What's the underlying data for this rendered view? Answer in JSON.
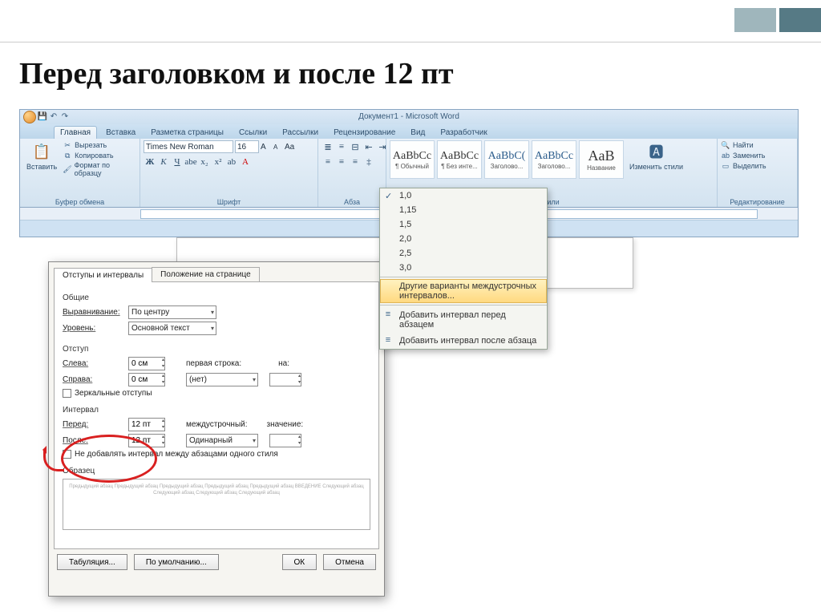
{
  "slide": {
    "heading": "Перед заголовком и после 12 пт"
  },
  "word": {
    "title": "Документ1 - Microsoft Word",
    "tabs": [
      "Главная",
      "Вставка",
      "Разметка страницы",
      "Ссылки",
      "Рассылки",
      "Рецензирование",
      "Вид",
      "Разработчик"
    ],
    "clipboard": {
      "label": "Буфер обмена",
      "paste": "Вставить",
      "cut": "Вырезать",
      "copy": "Копировать",
      "format_painter": "Формат по образцу"
    },
    "font": {
      "label": "Шрифт",
      "family": "Times New Roman",
      "size": "16"
    },
    "paragraph": {
      "label": "Абза"
    },
    "styles": {
      "label": "тили",
      "items": [
        {
          "preview": "AaBbCc",
          "name": "¶ Обычный"
        },
        {
          "preview": "AaBbCc",
          "name": "¶ Без инте..."
        },
        {
          "preview": "AaBbC(",
          "name": "Заголово..."
        },
        {
          "preview": "AaBbCc",
          "name": "Заголово..."
        },
        {
          "preview": "AaB",
          "name": "Название"
        }
      ],
      "change": "Изменить стили"
    },
    "editing": {
      "label": "Редактирование",
      "find": "Найти",
      "replace": "Заменить",
      "select": "Выделить"
    }
  },
  "dropdown": {
    "values": [
      "1,0",
      "1,15",
      "1,5",
      "2,0",
      "2,5",
      "3,0"
    ],
    "checked": "1,0",
    "highlighted": "Другие варианты междустрочных интервалов...",
    "add_before": "Добавить интервал перед абзацем",
    "add_after": "Добавить интервал после абзаца"
  },
  "dialog": {
    "tab1": "Отступы и интервалы",
    "tab2": "Положение на странице",
    "section_general": "Общие",
    "alignment_label": "Выравнивание:",
    "alignment_value": "По центру",
    "outline_label": "Уровень:",
    "outline_value": "Основной текст",
    "section_indent": "Отступ",
    "left_label": "Слева:",
    "left_value": "0 см",
    "right_label": "Справа:",
    "right_value": "0 см",
    "firstline_label": "первая строка:",
    "firstline_value": "(нет)",
    "by_label": "на:",
    "mirror": "Зеркальные отступы",
    "section_spacing": "Интервал",
    "before_label": "Перед:",
    "before_value": "12 пт",
    "after_label": "После:",
    "after_value": "12 пт",
    "linesp_label": "междустрочный:",
    "linesp_value": "Одинарный",
    "at_label": "значение:",
    "dont_add": "Не добавлять интервал между абзацами одного стиля",
    "section_preview": "Образец",
    "preview_text": "Предыдущий абзац Предыдущий абзац Предыдущий абзац Предыдущий абзац Предыдущий абзац\nВВЕДЕНИЕ\nСледующий абзац Следующий абзац Следующий абзац Следующий абзац",
    "tabs_btn": "Табуляция...",
    "default_btn": "По умолчанию...",
    "ok_btn": "ОК",
    "cancel_btn": "Отмена"
  }
}
